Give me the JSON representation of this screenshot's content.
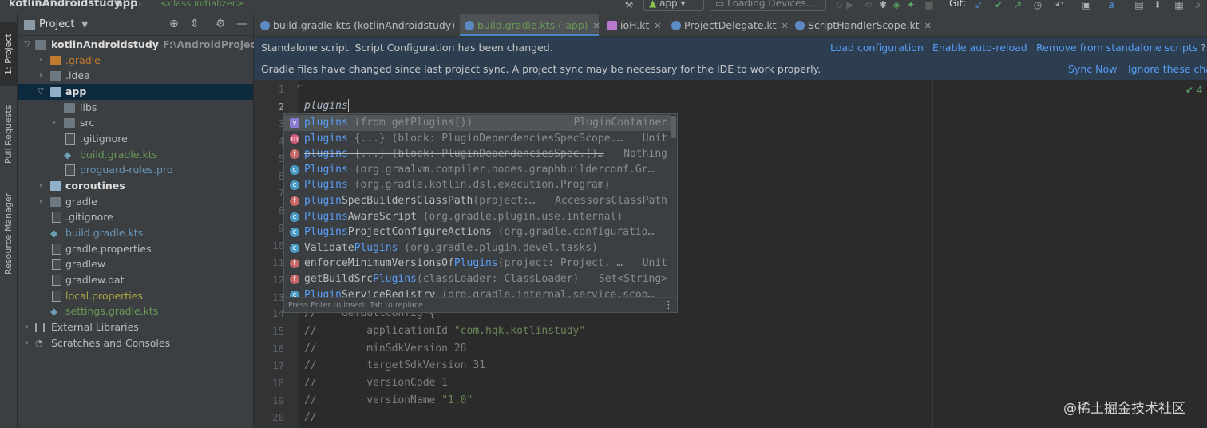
{
  "topbar": {
    "breadcrumb": [
      "kotlinAndroidstudy",
      "app"
    ],
    "context": "<class initializer>",
    "run_config": "app",
    "device": "Loading Devices...",
    "git_label": "Git:"
  },
  "leftstrip": {
    "tabs": [
      "1: Project",
      "Pull Requests",
      "Resource Manager"
    ]
  },
  "project": {
    "title": "Project",
    "tree": [
      {
        "label": "kotlinAndroidstudy",
        "path": "F:\\AndroidProjectDemo"
      },
      {
        "label": ".gradle"
      },
      {
        "label": ".idea"
      },
      {
        "label": "app"
      },
      {
        "label": "libs"
      },
      {
        "label": "src"
      },
      {
        "label": ".gitignore"
      },
      {
        "label": "build.gradle.kts"
      },
      {
        "label": "proguard-rules.pro"
      },
      {
        "label": "coroutines"
      },
      {
        "label": "gradle"
      },
      {
        "label": ".gitignore"
      },
      {
        "label": "build.gradle.kts"
      },
      {
        "label": "gradle.properties"
      },
      {
        "label": "gradlew"
      },
      {
        "label": "gradlew.bat"
      },
      {
        "label": "local.properties"
      },
      {
        "label": "settings.gradle.kts"
      },
      {
        "label": "External Libraries"
      },
      {
        "label": "Scratches and Consoles"
      }
    ]
  },
  "tabs": [
    {
      "label": "build.gradle.kts (kotlinAndroidstudy)"
    },
    {
      "label": "build.gradle.kts (:app)"
    },
    {
      "label": "ioH.kt"
    },
    {
      "label": "ProjectDelegate.kt"
    },
    {
      "label": "ScriptHandlerScope.kt"
    }
  ],
  "banner1": {
    "message": "Standalone script. Script Configuration has been changed.",
    "links": [
      "Load configuration",
      "Enable auto-reload",
      "Remove from standalone scripts"
    ]
  },
  "banner2": {
    "message": "Gradle files have changed since last project sync. A project sync may be necessary for the IDE to work properly.",
    "links": [
      "Sync Now",
      "Ignore these chan"
    ]
  },
  "editor": {
    "line_numbers": [
      "1",
      "2",
      "3",
      "4",
      "5",
      "6",
      "7",
      "8",
      "9",
      "10",
      "11",
      "12",
      "13",
      "14",
      "15",
      "16",
      "17",
      "18",
      "19",
      "20"
    ],
    "typed_text": "plugins",
    "inspection_count": "4",
    "visible_lines": [
      {
        "text": "//    defaultConfig {"
      },
      {
        "prefix": "//        applicationId ",
        "str": "\"com.hqk.kotlinstudy\""
      },
      {
        "text": "//        minSdkVersion 28"
      },
      {
        "text": "//        targetSdkVersion 31"
      },
      {
        "text": "//        versionCode 1"
      },
      {
        "prefix": "//        versionName ",
        "str": "\"1.0\""
      },
      {
        "text": "//"
      }
    ]
  },
  "completion": {
    "items": [
      {
        "kind": "v",
        "match": "plugins",
        "rest": "",
        "tail": " (from getPlugins())",
        "type": "PluginContainer"
      },
      {
        "kind": "m",
        "match": "plugins",
        "rest": "",
        "tail": " {...} (block: PluginDependenciesSpecScope.…",
        "type": "Unit"
      },
      {
        "kind": "f",
        "match": "plugins",
        "rest": "",
        "tail": " {...} (block: PluginDependenciesSpec.()…",
        "type": "Nothing"
      },
      {
        "kind": "c",
        "match": "Plugins",
        "rest": "",
        "tail": " (org.graalvm.compiler.nodes.graphbuilderconf.Gr…",
        "type": ""
      },
      {
        "kind": "c",
        "match": "Plugins",
        "rest": "",
        "tail": " (org.gradle.kotlin.dsl.execution.Program)",
        "type": ""
      },
      {
        "kind": "f",
        "match": "plugin",
        "rest": "SpecBuildersClassPath",
        "tail": "(project:…",
        "type": "AccessorsClassPath"
      },
      {
        "kind": "c",
        "match": "Plugins",
        "rest": "AwareScript",
        "tail": " (org.gradle.plugin.use.internal)",
        "type": ""
      },
      {
        "kind": "c",
        "match": "Plugins",
        "rest": "ProjectConfigureActions",
        "tail": " (org.gradle.configuratio…",
        "type": ""
      },
      {
        "kind": "c",
        "prefix": "Validate",
        "match": "Plugins",
        "rest": "",
        "tail": " (org.gradle.plugin.devel.tasks)",
        "type": ""
      },
      {
        "kind": "f",
        "prefix": "enforceMinimumVersionsOf",
        "match": "Plugins",
        "rest": "",
        "tail": "(project: Project, …",
        "type": "Unit"
      },
      {
        "kind": "f",
        "prefix": "getBuildSrc",
        "match": "Plugins",
        "rest": "",
        "tail": "(classLoader: ClassLoader)",
        "type": "Set<String>"
      },
      {
        "kind": "c",
        "match": "Plugin",
        "rest": "ServiceRegistry",
        "tail": " (org.gradle.internal.service.scop…",
        "type": ""
      }
    ],
    "footer": "Press Enter to insert, Tab to replace"
  },
  "watermark": "@稀土掘金技术社区",
  "colors": {
    "link": "#589df6",
    "banner_bg": "#2c3e50",
    "panel_bg": "#3c3f41",
    "editor_bg": "#2b2b2b",
    "selection": "#0d293e"
  }
}
